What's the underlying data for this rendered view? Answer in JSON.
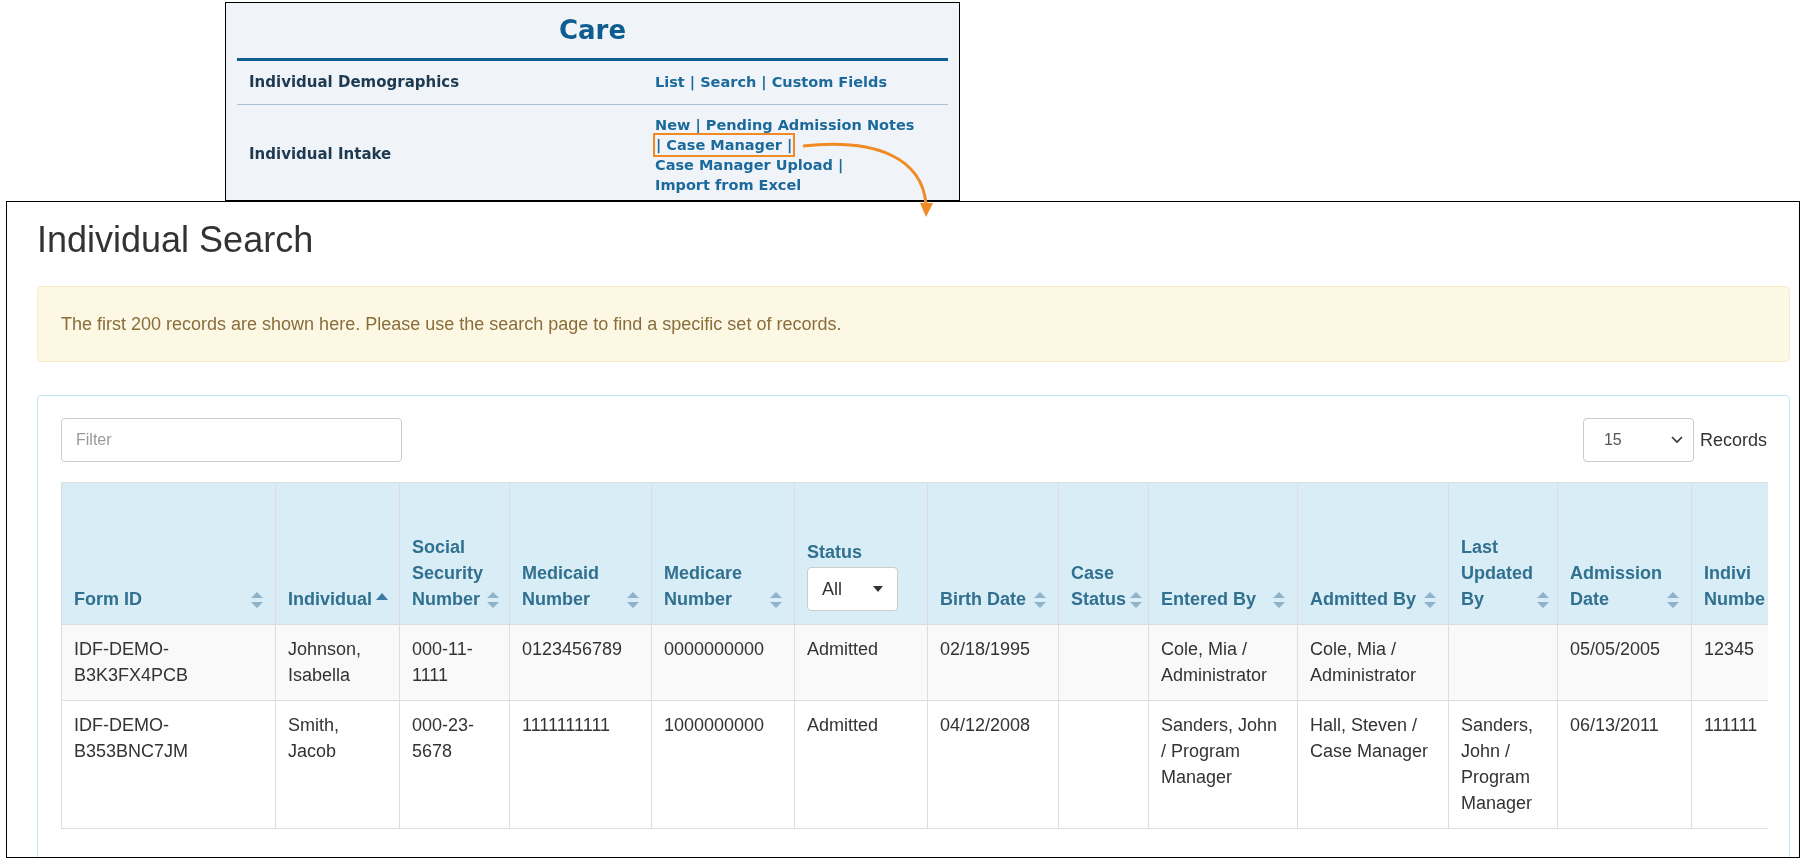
{
  "care_menu": {
    "title": "Care",
    "rows": [
      {
        "label": "Individual Demographics",
        "lines": [
          {
            "text": "List | Search | Custom Fields",
            "highlighted": false
          }
        ]
      },
      {
        "label": "Individual Intake",
        "lines": [
          {
            "text": "New | Pending Admission Notes",
            "highlighted": false
          },
          {
            "text": "| Case Manager |",
            "highlighted": true
          },
          {
            "text": "Case Manager Upload |",
            "highlighted": false
          },
          {
            "text": "Import from Excel",
            "highlighted": false
          }
        ]
      }
    ]
  },
  "page": {
    "title": "Individual Search",
    "alert": "The first 200 records are shown here. Please use the search page to find a specific set of records.",
    "filter": {
      "placeholder": "Filter"
    },
    "page_size": {
      "value": "15",
      "label": "Records"
    }
  },
  "table": {
    "columns": [
      {
        "label": "Form ID",
        "sorted": false
      },
      {
        "label": "Individual",
        "sorted": true
      },
      {
        "label": "Social Security Number",
        "sorted": false
      },
      {
        "label": "Medicaid Number",
        "sorted": false
      },
      {
        "label": "Medicare Number",
        "sorted": false
      },
      {
        "label": "Status",
        "kind": "select",
        "filter": "All"
      },
      {
        "label": "Birth Date",
        "sorted": false
      },
      {
        "label": "Case Status",
        "sorted": false
      },
      {
        "label": "Entered By",
        "sorted": false
      },
      {
        "label": "Admitted By",
        "sorted": false
      },
      {
        "label": "Last Updated By",
        "sorted": false
      },
      {
        "label": "Admission Date",
        "sorted": false
      },
      {
        "label": "Indivi Numbe"
      }
    ],
    "rows": [
      [
        "IDF-DEMO-B3K3FX4PCB",
        "Johnson, Isabella",
        "000-11-1111",
        "0123456789",
        "0000000000",
        "Admitted",
        "02/18/1995",
        "",
        "Cole, Mia / Administrator",
        "Cole, Mia / Administrator",
        "",
        "05/05/2005",
        "12345"
      ],
      [
        "IDF-DEMO-B353BNC7JM",
        "Smith, Jacob",
        "000-23-5678",
        "1111111111",
        "1000000000",
        "Admitted",
        "04/12/2008",
        "",
        "Sanders, John / Program Manager",
        "Hall, Steven / Case Manager",
        "Sanders, John / Program Manager",
        "06/13/2011",
        "111111"
      ]
    ]
  }
}
